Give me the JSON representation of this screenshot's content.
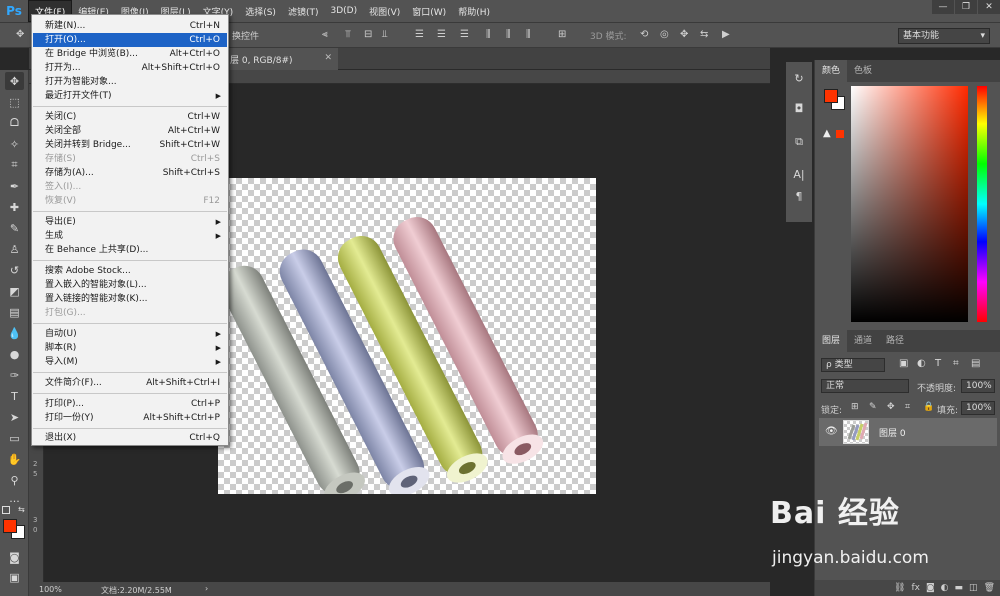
{
  "app": {
    "logo": "Ps"
  },
  "menubar": {
    "items": [
      "文件(F)",
      "编辑(E)",
      "图像(I)",
      "图层(L)",
      "文字(Y)",
      "选择(S)",
      "滤镜(T)",
      "3D(D)",
      "视图(V)",
      "窗口(W)",
      "帮助(H)"
    ]
  },
  "options": {
    "show_controls": "换控件",
    "mode_3d": "3D 模式:",
    "workspace": "基本功能"
  },
  "document": {
    "tab_title": "层 0, RGB/8#)",
    "zoom": "100%",
    "doc_info": "文档:2.20M/2.55M"
  },
  "file_menu": {
    "items": [
      {
        "label": "新建(N)...",
        "shortcut": "Ctrl+N"
      },
      {
        "label": "打开(O)...",
        "shortcut": "Ctrl+O",
        "highlighted": true
      },
      {
        "label": "在 Bridge 中浏览(B)...",
        "shortcut": "Alt+Ctrl+O"
      },
      {
        "label": "打开为...",
        "shortcut": "Alt+Shift+Ctrl+O"
      },
      {
        "label": "打开为智能对象..."
      },
      {
        "label": "最近打开文件(T)",
        "submenu": true
      },
      {
        "label": "关闭(C)",
        "shortcut": "Ctrl+W"
      },
      {
        "label": "关闭全部",
        "shortcut": "Alt+Ctrl+W"
      },
      {
        "label": "关闭并转到 Bridge...",
        "shortcut": "Shift+Ctrl+W"
      },
      {
        "label": "存储(S)",
        "shortcut": "Ctrl+S",
        "disabled": true
      },
      {
        "label": "存储为(A)...",
        "shortcut": "Shift+Ctrl+S"
      },
      {
        "label": "签入(I)...",
        "disabled": true
      },
      {
        "label": "恢复(V)",
        "shortcut": "F12",
        "disabled": true
      },
      {
        "label": "导出(E)",
        "submenu": true
      },
      {
        "label": "生成",
        "submenu": true
      },
      {
        "label": "在 Behance 上共享(D)..."
      },
      {
        "label": "搜索 Adobe Stock..."
      },
      {
        "label": "置入嵌入的智能对象(L)..."
      },
      {
        "label": "置入链接的智能对象(K)..."
      },
      {
        "label": "打包(G)...",
        "disabled": true
      },
      {
        "label": "自动(U)",
        "submenu": true
      },
      {
        "label": "脚本(R)",
        "submenu": true
      },
      {
        "label": "导入(M)",
        "submenu": true
      },
      {
        "label": "文件简介(F)...",
        "shortcut": "Alt+Shift+Ctrl+I"
      },
      {
        "label": "打印(P)...",
        "shortcut": "Ctrl+P"
      },
      {
        "label": "打印一份(Y)",
        "shortcut": "Alt+Shift+Ctrl+P"
      },
      {
        "label": "退出(X)",
        "shortcut": "Ctrl+Q"
      }
    ]
  },
  "rulers": {
    "v_ticks": [
      "2",
      "5",
      "3",
      "0"
    ]
  },
  "color_panel": {
    "tabs": [
      "颜色",
      "色板"
    ],
    "foreground": "#ff3300",
    "background": "#ffffff"
  },
  "layers_panel": {
    "tabs": [
      "图层",
      "通道",
      "路径"
    ],
    "filter_kind": "ρ 类型",
    "blend_mode": "正常",
    "opacity_label": "不透明度:",
    "opacity": "100%",
    "lock_label": "锁定:",
    "fill_label": "填充:",
    "fill": "100%",
    "layers": [
      {
        "name": "图层 0",
        "visible": true
      }
    ]
  },
  "footer_icons": [
    "link-icon",
    "fx-icon",
    "mask-icon",
    "adjust-icon",
    "folder-icon",
    "new-layer-icon",
    "trash-icon"
  ],
  "watermark": {
    "text": "Bai 经验",
    "url": "jingyan.baidu.com"
  }
}
